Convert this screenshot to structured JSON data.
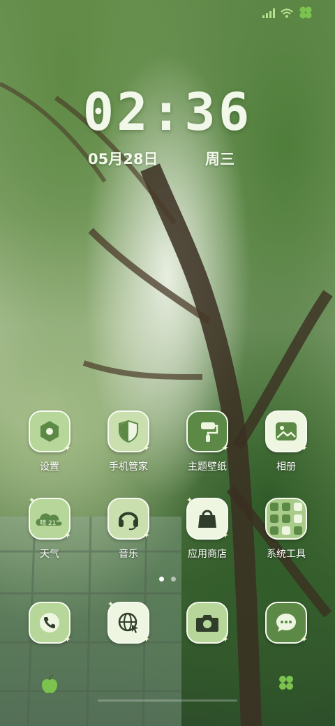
{
  "status_bar": {
    "icons": [
      "signal-icon",
      "wifi-icon",
      "clover-icon"
    ]
  },
  "clock": {
    "time": "02:36",
    "date": "05月28日",
    "weekday": "周三"
  },
  "apps": [
    {
      "label": "设置",
      "icon": "hexagon-nut-icon"
    },
    {
      "label": "手机管家",
      "icon": "shield-icon"
    },
    {
      "label": "主题壁纸",
      "icon": "paint-roller-icon"
    },
    {
      "label": "相册",
      "icon": "picture-icon"
    },
    {
      "label": "天气",
      "icon": "cloud-sun-icon",
      "badge": "晴 21°"
    },
    {
      "label": "音乐",
      "icon": "headphones-icon"
    },
    {
      "label": "应用商店",
      "icon": "shopping-bag-icon"
    },
    {
      "label": "系统工具",
      "icon": "folder-grid-icon"
    }
  ],
  "page_indicator": {
    "count": 2,
    "active": 0
  },
  "dock": [
    {
      "icon": "phone-icon"
    },
    {
      "icon": "globe-browser-icon"
    },
    {
      "icon": "camera-icon"
    },
    {
      "icon": "message-icon"
    }
  ],
  "colors": {
    "icon_bg": "#b7d79a",
    "icon_dark": "#5c8a46",
    "text": "#ffffff"
  }
}
